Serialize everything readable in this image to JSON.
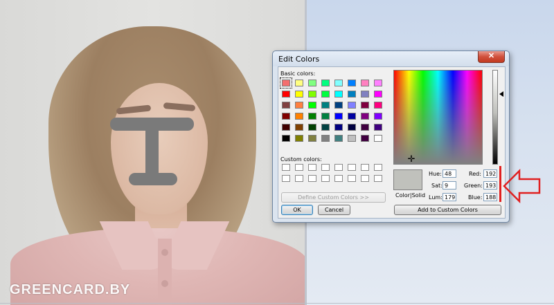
{
  "photo": {
    "watermark": "GREENCARD.BY"
  },
  "dialog": {
    "title": "Edit Colors",
    "close_label": "✕",
    "basic_colors_label": "Basic colors:",
    "custom_colors_label": "Custom colors:",
    "basic_colors": [
      [
        "#f46e6e",
        "#ffff80",
        "#80ff80",
        "#00ff80",
        "#80ffff",
        "#0080ff",
        "#ff80c0",
        "#ff80ff"
      ],
      [
        "#ff0000",
        "#ffff00",
        "#80ff00",
        "#00ff40",
        "#00ffff",
        "#0080c0",
        "#8080c0",
        "#ff00ff"
      ],
      [
        "#804040",
        "#ff8040",
        "#00ff00",
        "#008080",
        "#004080",
        "#8080ff",
        "#800040",
        "#ff0080"
      ],
      [
        "#800000",
        "#ff8000",
        "#008000",
        "#008040",
        "#0000ff",
        "#0000a0",
        "#800080",
        "#8000ff"
      ],
      [
        "#400000",
        "#804000",
        "#004000",
        "#004040",
        "#000080",
        "#000040",
        "#400040",
        "#400080"
      ],
      [
        "#000000",
        "#808000",
        "#808040",
        "#808080",
        "#408080",
        "#c0c0c0",
        "#400040",
        "#ffffff"
      ]
    ],
    "selected_basic": "#f46e6e",
    "custom_colors": [
      [
        "#ffffff",
        "#ffffff",
        "#ffffff",
        "#ffffff",
        "#ffffff",
        "#ffffff",
        "#ffffff",
        "#ffffff"
      ],
      [
        "#ffffff",
        "#ffffff",
        "#ffffff",
        "#ffffff",
        "#ffffff",
        "#ffffff",
        "#ffffff",
        "#ffffff"
      ]
    ],
    "define_custom_label": "Define Custom Colors >>",
    "ok_label": "OK",
    "cancel_label": "Cancel",
    "color_solid_label": "Color|Solid",
    "preview_color": "#c0c1bc",
    "hue_label": "Hue:",
    "hue_value": "48",
    "sat_label": "Sat:",
    "sat_value": "9",
    "lum_label": "Lum:",
    "lum_value": "179",
    "red_label": "Red:",
    "red_value": "192",
    "green_label": "Green:",
    "green_value": "193",
    "blue_label": "Blue:",
    "blue_value": "188",
    "add_custom_label": "Add to Custom Colors"
  },
  "annotation": {
    "color": "#e02020"
  }
}
